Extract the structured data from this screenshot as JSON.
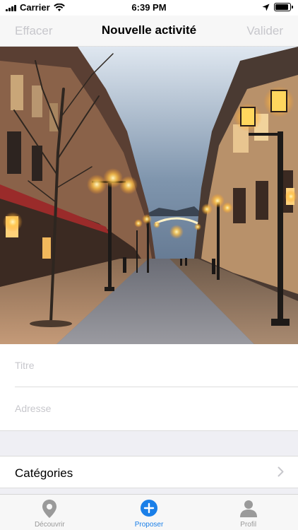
{
  "status_bar": {
    "carrier": "Carrier",
    "time": "6:39 PM",
    "battery_level": 0.9
  },
  "nav": {
    "left_label": "Effacer",
    "title": "Nouvelle activité",
    "right_label": "Valider"
  },
  "photo": {
    "subject": "street-photo"
  },
  "form": {
    "title_placeholder": "Titre",
    "title_value": "",
    "address_placeholder": "Adresse",
    "address_value": ""
  },
  "categories": {
    "label": "Catégories"
  },
  "tabs": [
    {
      "label": "Découvrir",
      "icon": "location-pin-icon",
      "active": false
    },
    {
      "label": "Proposer",
      "icon": "add-circle-icon",
      "active": true
    },
    {
      "label": "Profil",
      "icon": "profile-icon",
      "active": false
    }
  ],
  "colors": {
    "accent": "#1a7fe8",
    "disabled": "#c7c7cc",
    "inactive_tab": "#999999",
    "group_bg": "#efeff4"
  }
}
